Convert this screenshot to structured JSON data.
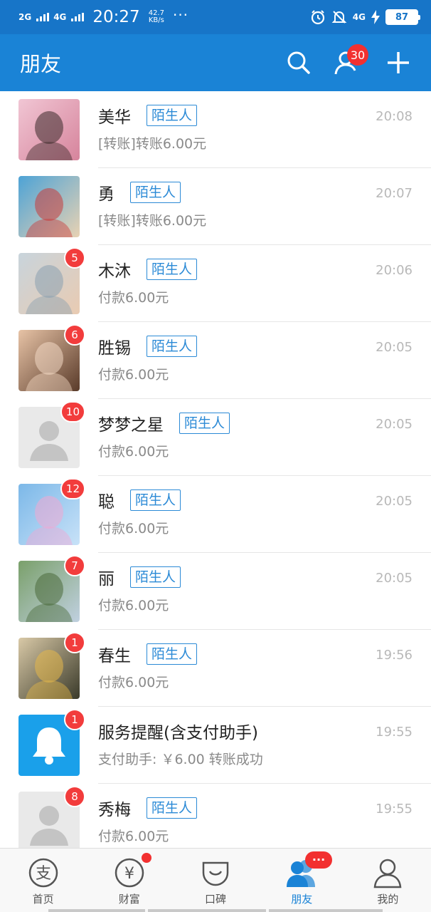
{
  "status_bar": {
    "network1": "2G",
    "network2": "4G",
    "time": "20:27",
    "speed_value": "42.7",
    "speed_unit": "KB/s",
    "dots": "···",
    "network3": "4G",
    "battery": "87"
  },
  "header": {
    "title": "朋友",
    "contacts_badge": "30"
  },
  "conversations": [
    {
      "name": "美华",
      "tag": "陌生人",
      "message": "[转账]转账6.00元",
      "time": "20:08",
      "badge": "",
      "avatar": "photo"
    },
    {
      "name": "勇",
      "tag": "陌生人",
      "message": "[转账]转账6.00元",
      "time": "20:07",
      "badge": "",
      "avatar": "photo"
    },
    {
      "name": "木沐",
      "tag": "陌生人",
      "message": "付款6.00元",
      "time": "20:06",
      "badge": "5",
      "avatar": "photo"
    },
    {
      "name": "胜锡",
      "tag": "陌生人",
      "message": "付款6.00元",
      "time": "20:05",
      "badge": "6",
      "avatar": "photo"
    },
    {
      "name": "梦梦之星",
      "tag": "陌生人",
      "message": "付款6.00元",
      "time": "20:05",
      "badge": "10",
      "avatar": "default"
    },
    {
      "name": "聪",
      "tag": "陌生人",
      "message": "付款6.00元",
      "time": "20:05",
      "badge": "12",
      "avatar": "photo"
    },
    {
      "name": "丽",
      "tag": "陌生人",
      "message": "付款6.00元",
      "time": "20:05",
      "badge": "7",
      "avatar": "photo"
    },
    {
      "name": "春生",
      "tag": "陌生人",
      "message": "付款6.00元",
      "time": "19:56",
      "badge": "1",
      "avatar": "photo"
    },
    {
      "name": "服务提醒(含支付助手)",
      "tag": "",
      "message": "支付助手: ￥6.00 转账成功",
      "time": "19:55",
      "badge": "1",
      "avatar": "bell"
    },
    {
      "name": "秀梅",
      "tag": "陌生人",
      "message": "付款6.00元",
      "time": "19:55",
      "badge": "8",
      "avatar": "default"
    }
  ],
  "tabs": [
    {
      "label": "首页",
      "icon": "alipay-icon"
    },
    {
      "label": "财富",
      "icon": "yuan-icon"
    },
    {
      "label": "口碑",
      "icon": "koubei-icon"
    },
    {
      "label": "朋友",
      "icon": "friends-icon"
    },
    {
      "label": "我的",
      "icon": "user-icon"
    }
  ],
  "tab_more_dots": "···",
  "colors": {
    "status_bar": "#1775c8",
    "header": "#1a83d6",
    "badge": "#f23030",
    "tag": "#2b8ad6"
  }
}
